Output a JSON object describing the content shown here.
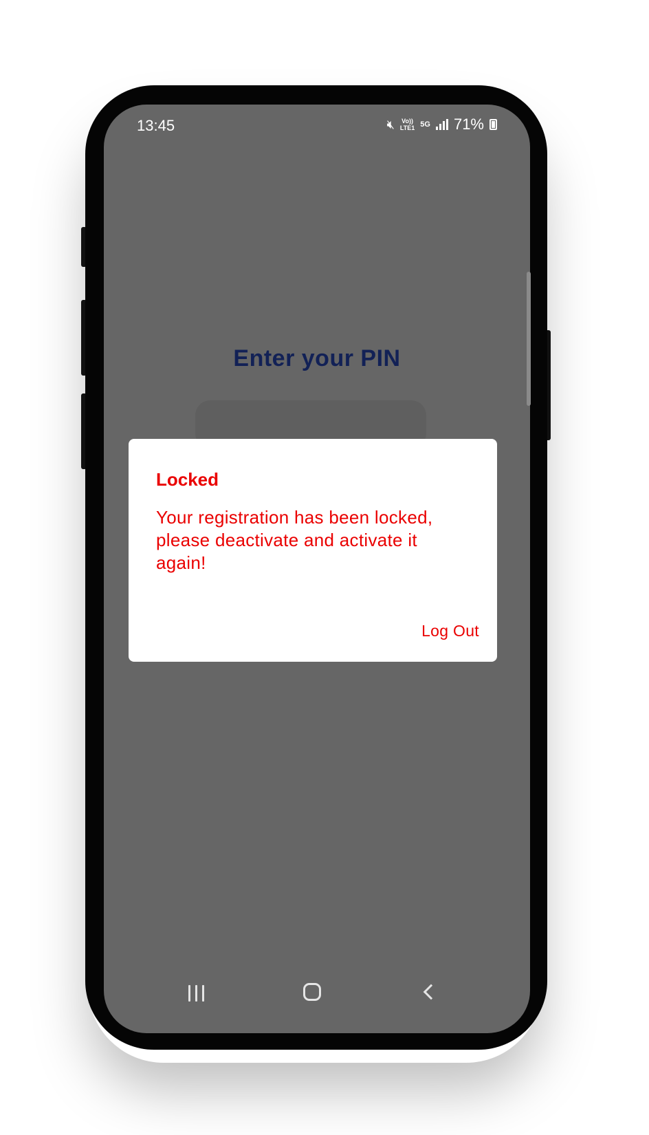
{
  "status_bar": {
    "time": "13:45",
    "volte_label_top": "Vo))",
    "volte_label_bottom": "LTE1",
    "network_label": "5G",
    "battery_percent": "71%",
    "icons": [
      "mute-icon",
      "volte-icon",
      "5g-icon",
      "signal-icon",
      "battery-icon"
    ]
  },
  "screen": {
    "title": "Enter your PIN"
  },
  "dialog": {
    "title": "Locked",
    "message": "Your registration has been locked, please deactivate and activate it again!",
    "button_label": "Log Out"
  },
  "navigation_bar": {
    "icons": [
      "recent-apps-icon",
      "home-icon",
      "back-icon"
    ]
  },
  "colors": {
    "screen_background": "#666666",
    "title_color": "#122156",
    "dialog_text": "#ea0000",
    "dialog_background": "#ffffff"
  }
}
